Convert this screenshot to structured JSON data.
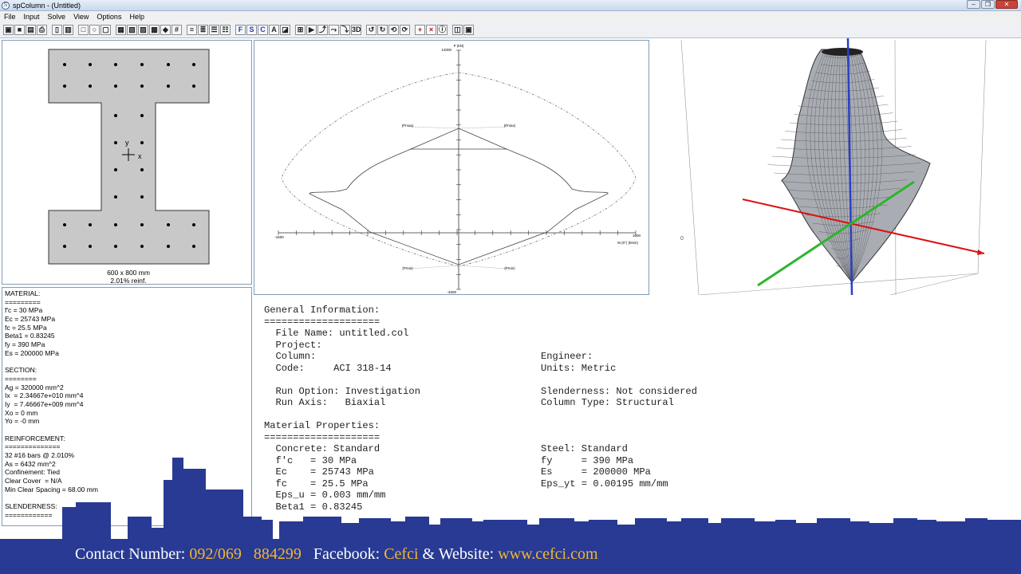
{
  "window": {
    "title": "spColumn - (Untitled)",
    "app_icon": "S"
  },
  "window_buttons": {
    "minimize": "–",
    "restore": "❐",
    "close": "✕"
  },
  "menu": [
    "File",
    "Input",
    "Solve",
    "View",
    "Options",
    "Help"
  ],
  "toolbar": {
    "buttons": [
      {
        "name": "open-icon",
        "glyph": "▣"
      },
      {
        "name": "save-icon",
        "glyph": "■"
      },
      {
        "name": "print-preview-icon",
        "glyph": "▤"
      },
      {
        "name": "print-icon",
        "glyph": "⎙"
      },
      {
        "name": "sep",
        "glyph": ""
      },
      {
        "name": "page-icon",
        "glyph": "▯"
      },
      {
        "name": "report-icon",
        "glyph": "▥"
      },
      {
        "name": "sep",
        "glyph": ""
      },
      {
        "name": "rectangle-section-icon",
        "glyph": "□"
      },
      {
        "name": "circle-section-icon",
        "glyph": "○"
      },
      {
        "name": "irregular-section-icon",
        "glyph": "▢"
      },
      {
        "name": "sep",
        "glyph": ""
      },
      {
        "name": "bars-all-sides-icon",
        "glyph": "▦"
      },
      {
        "name": "bars-two-sides-icon",
        "glyph": "▧"
      },
      {
        "name": "bars-sides-icon",
        "glyph": "▨"
      },
      {
        "name": "bars-circle-icon",
        "glyph": "▩"
      },
      {
        "name": "bar-color-icon",
        "glyph": "◆"
      },
      {
        "name": "grid-icon",
        "glyph": "#"
      },
      {
        "name": "sep",
        "glyph": ""
      },
      {
        "name": "loads-1-icon",
        "glyph": "≡"
      },
      {
        "name": "loads-2-icon",
        "glyph": "≣"
      },
      {
        "name": "loads-3-icon",
        "glyph": "☰"
      },
      {
        "name": "loads-4-icon",
        "glyph": "☷"
      },
      {
        "name": "sep",
        "glyph": ""
      },
      {
        "name": "factored-loads-icon",
        "glyph": "F"
      },
      {
        "name": "service-loads-icon",
        "glyph": "S"
      },
      {
        "name": "control-points-icon",
        "glyph": "C"
      },
      {
        "name": "axial-loads-icon",
        "glyph": "A"
      },
      {
        "name": "moment-loads-icon",
        "glyph": "◪"
      },
      {
        "name": "sep",
        "glyph": ""
      },
      {
        "name": "design-criteria-icon",
        "glyph": "⊞"
      },
      {
        "name": "execute-icon",
        "glyph": "▶"
      },
      {
        "name": "diagram-icon",
        "glyph": "⤴"
      },
      {
        "name": "pm-diagram-icon",
        "glyph": "⤳"
      },
      {
        "name": "mm-diagram-icon",
        "glyph": "⤵"
      },
      {
        "name": "view-3d-icon",
        "glyph": "3D"
      },
      {
        "name": "sep",
        "glyph": ""
      },
      {
        "name": "rotate-up-icon",
        "glyph": "↺"
      },
      {
        "name": "rotate-down-icon",
        "glyph": "↻"
      },
      {
        "name": "rotate-left-icon",
        "glyph": "⟲"
      },
      {
        "name": "rotate-right-icon",
        "glyph": "⟳"
      },
      {
        "name": "sep",
        "glyph": ""
      },
      {
        "name": "add-bar-icon",
        "glyph": "+"
      },
      {
        "name": "delete-bar-icon",
        "glyph": "×"
      },
      {
        "name": "properties-icon",
        "glyph": "ⓘ"
      },
      {
        "name": "sep",
        "glyph": ""
      },
      {
        "name": "window-tile-icon",
        "glyph": "◫"
      },
      {
        "name": "window-cascade-icon",
        "glyph": "▣"
      }
    ]
  },
  "section": {
    "caption_size": "600 x 800 mm",
    "caption_reinf": "2.01% reinf.",
    "axis_y": "y",
    "axis_x": "x"
  },
  "diagram": {
    "axis_top": "12000",
    "axis_bottom": "-4000",
    "axis_left": "-1600",
    "axis_right": "1600",
    "p_label": "P (kN)",
    "m_label": "M (0°) (kNm)",
    "pmax_left": "(Pmax)",
    "pmax_right": "(Pmax)",
    "pmin_left": "(Pmin)",
    "pmin_right": "(Pmin)"
  },
  "view3d": {
    "axis_label": "0"
  },
  "properties": {
    "lines": [
      "MATERIAL:",
      "=========",
      "f'c = 30 MPa",
      "Ec = 25743 MPa",
      "fc = 25.5 MPa",
      "Beta1 = 0.83245",
      "fy = 390 MPa",
      "Es = 200000 MPa",
      "",
      "SECTION:",
      "========",
      "Ag = 320000 mm^2",
      "Ix  = 2.34667e+010 mm^4",
      "Iy  = 7.46667e+009 mm^4",
      "Xo = 0 mm",
      "Yo = -0 mm",
      "",
      "REINFORCEMENT:",
      "==============",
      "32 #16 bars @ 2.010%",
      "As = 6432 mm^2",
      "Confinement: Tied",
      "Clear Cover  = N/A",
      "Min Clear Spacing = 68.00 mm",
      "",
      "SLENDERNESS:",
      "============"
    ]
  },
  "report": {
    "lines": [
      {
        "left": "General Information:",
        "right": ""
      },
      {
        "left": "====================",
        "right": ""
      },
      {
        "left": "  File Name: untitled.col",
        "right": ""
      },
      {
        "left": "  Project:",
        "right": ""
      },
      {
        "left": "  Column:",
        "right": "Engineer:"
      },
      {
        "left": "  Code:     ACI 318-14",
        "right": "Units: Metric"
      },
      {
        "left": "",
        "right": ""
      },
      {
        "left": "  Run Option: Investigation",
        "right": "Slenderness: Not considered"
      },
      {
        "left": "  Run Axis:   Biaxial",
        "right": "Column Type: Structural"
      },
      {
        "left": "",
        "right": ""
      },
      {
        "left": "Material Properties:",
        "right": ""
      },
      {
        "left": "====================",
        "right": ""
      },
      {
        "left": "  Concrete: Standard",
        "right": "Steel: Standard"
      },
      {
        "left": "  f'c   = 30 MPa",
        "right": "fy     = 390 MPa"
      },
      {
        "left": "  Ec    = 25743 MPa",
        "right": "Es     = 200000 MPa"
      },
      {
        "left": "  fc    = 25.5 MPa",
        "right": "Eps_yt = 0.00195 mm/mm"
      },
      {
        "left": "  Eps_u = 0.003 mm/mm",
        "right": ""
      },
      {
        "left": "  Beta1 = 0.83245",
        "right": ""
      }
    ]
  },
  "contact": {
    "number_label": "Contact Number: ",
    "number_value": "092/069   884299",
    "facebook_label": "   Facebook: ",
    "facebook_value": "Cefci",
    "website_label": " & Website: ",
    "website_value": "www.cefci.com"
  },
  "colors": {
    "banner": "#283a94",
    "gold": "#f2b631",
    "section_fill": "#c8c8c8"
  }
}
